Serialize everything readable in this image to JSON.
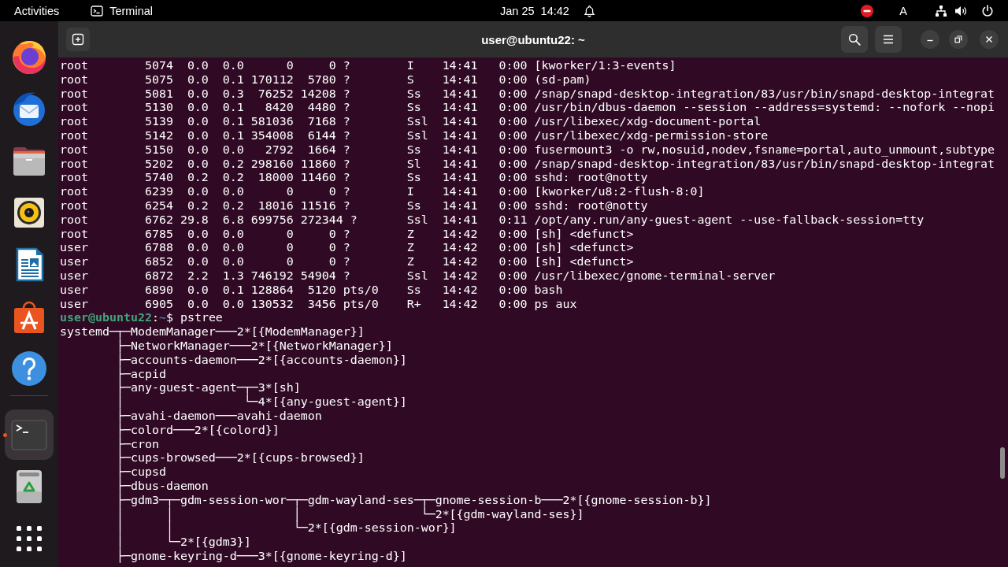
{
  "top_bar": {
    "activities": "Activities",
    "app_menu": "Terminal",
    "clock": "Jan 25  14:42",
    "input_source": "A"
  },
  "dock": {
    "favorites": [
      {
        "kind": "browser",
        "selected": false,
        "running": false
      },
      {
        "kind": "mail",
        "selected": false,
        "running": false
      },
      {
        "kind": "files",
        "selected": false,
        "running": false
      },
      {
        "kind": "music",
        "selected": false,
        "running": false
      },
      {
        "kind": "writer",
        "selected": false,
        "running": false
      },
      {
        "kind": "store",
        "selected": false,
        "running": false
      },
      {
        "kind": "help",
        "selected": false,
        "running": false
      }
    ],
    "other": [
      {
        "kind": "terminal",
        "selected": true,
        "running": true
      },
      {
        "kind": "trash",
        "selected": false,
        "running": false
      }
    ]
  },
  "terminal": {
    "title": "user@ubuntu22: ~",
    "lines": [
      {
        "kind": "output",
        "text": "root        5074  0.0  0.0      0     0 ?        I    14:41   0:00 [kworker/1:3-events]"
      },
      {
        "kind": "output",
        "text": "root        5075  0.0  0.1 170112  5780 ?        S    14:41   0:00 (sd-pam)"
      },
      {
        "kind": "output",
        "text": "root        5081  0.0  0.3  76252 14208 ?        Ss   14:41   0:00 /snap/snapd-desktop-integration/83/usr/bin/snapd-desktop-integrat"
      },
      {
        "kind": "output",
        "text": "root        5130  0.0  0.1   8420  4480 ?        Ss   14:41   0:00 /usr/bin/dbus-daemon --session --address=systemd: --nofork --nopi"
      },
      {
        "kind": "output",
        "text": "root        5139  0.0  0.1 581036  7168 ?        Ssl  14:41   0:00 /usr/libexec/xdg-document-portal"
      },
      {
        "kind": "output",
        "text": "root        5142  0.0  0.1 354008  6144 ?        Ssl  14:41   0:00 /usr/libexec/xdg-permission-store"
      },
      {
        "kind": "output",
        "text": "root        5150  0.0  0.0   2792  1664 ?        Ss   14:41   0:00 fusermount3 -o rw,nosuid,nodev,fsname=portal,auto_unmount,subtype"
      },
      {
        "kind": "output",
        "text": "root        5202  0.0  0.2 298160 11860 ?        Sl   14:41   0:00 /snap/snapd-desktop-integration/83/usr/bin/snapd-desktop-integrat"
      },
      {
        "kind": "output",
        "text": "root        5740  0.2  0.2  18000 11460 ?        Ss   14:41   0:00 sshd: root@notty"
      },
      {
        "kind": "output",
        "text": "root        6239  0.0  0.0      0     0 ?        I    14:41   0:00 [kworker/u8:2-flush-8:0]"
      },
      {
        "kind": "output",
        "text": "root        6254  0.2  0.2  18016 11516 ?        Ss   14:41   0:00 sshd: root@notty"
      },
      {
        "kind": "output",
        "text": "root        6762 29.8  6.8 699756 272344 ?       Ssl  14:41   0:11 /opt/any.run/any-guest-agent --use-fallback-session=tty"
      },
      {
        "kind": "output",
        "text": "root        6785  0.0  0.0      0     0 ?        Z    14:42   0:00 [sh] <defunct>"
      },
      {
        "kind": "output",
        "text": "user        6788  0.0  0.0      0     0 ?        Z    14:42   0:00 [sh] <defunct>"
      },
      {
        "kind": "output",
        "text": "user        6852  0.0  0.0      0     0 ?        Z    14:42   0:00 [sh] <defunct>"
      },
      {
        "kind": "output",
        "text": "user        6872  2.2  1.3 746192 54904 ?        Ssl  14:42   0:00 /usr/libexec/gnome-terminal-server"
      },
      {
        "kind": "output",
        "text": "user        6890  0.0  0.1 128864  5120 pts/0    Ss   14:42   0:00 bash"
      },
      {
        "kind": "output",
        "text": "user        6905  0.0  0.0 130532  3456 pts/0    R+   14:42   0:00 ps aux"
      },
      {
        "kind": "prompt",
        "user_host": "user@ubuntu22",
        "separator": ":",
        "path": "~",
        "symbol": "$",
        "command": "pstree"
      },
      {
        "kind": "output",
        "text": "systemd─┬─ModemManager───2*[{ModemManager}]"
      },
      {
        "kind": "output",
        "text": "        ├─NetworkManager───2*[{NetworkManager}]"
      },
      {
        "kind": "output",
        "text": "        ├─accounts-daemon───2*[{accounts-daemon}]"
      },
      {
        "kind": "output",
        "text": "        ├─acpid"
      },
      {
        "kind": "output",
        "text": "        ├─any-guest-agent─┬─3*[sh]"
      },
      {
        "kind": "output",
        "text": "        │                 └─4*[{any-guest-agent}]"
      },
      {
        "kind": "output",
        "text": "        ├─avahi-daemon───avahi-daemon"
      },
      {
        "kind": "output",
        "text": "        ├─colord───2*[{colord}]"
      },
      {
        "kind": "output",
        "text": "        ├─cron"
      },
      {
        "kind": "output",
        "text": "        ├─cups-browsed───2*[{cups-browsed}]"
      },
      {
        "kind": "output",
        "text": "        ├─cupsd"
      },
      {
        "kind": "output",
        "text": "        ├─dbus-daemon"
      },
      {
        "kind": "output",
        "text": "        ├─gdm3─┬─gdm-session-wor─┬─gdm-wayland-ses─┬─gnome-session-b───2*[{gnome-session-b}]"
      },
      {
        "kind": "output",
        "text": "        │      │                 │                 └─2*[{gdm-wayland-ses}]"
      },
      {
        "kind": "output",
        "text": "        │      │                 └─2*[{gdm-session-wor}]"
      },
      {
        "kind": "output",
        "text": "        │      └─2*[{gdm3}]"
      },
      {
        "kind": "output",
        "text": "        ├─gnome-keyring-d───3*[{gnome-keyring-d}]"
      }
    ]
  }
}
